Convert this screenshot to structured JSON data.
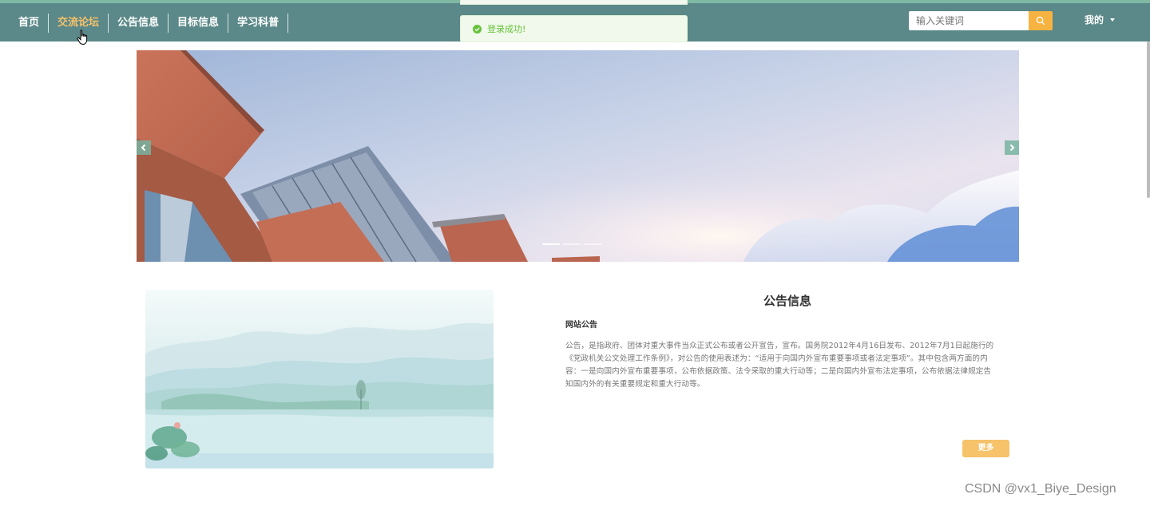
{
  "nav": {
    "items": [
      {
        "label": "首页"
      },
      {
        "label": "交流论坛"
      },
      {
        "label": "公告信息"
      },
      {
        "label": "目标信息"
      },
      {
        "label": "学习科普"
      }
    ]
  },
  "search": {
    "placeholder": "输入关键词"
  },
  "user_menu": {
    "label": "我的"
  },
  "toast": {
    "message": "登录成功!"
  },
  "notice": {
    "heading": "公告信息",
    "subtitle": "网站公告",
    "body": "公告，是指政府、团体对重大事件当众正式公布或者公开宣告，宣布。国务院2012年4月16日发布、2012年7月1日起施行的《党政机关公文处理工作条例》，对公告的使用表述为：“适用于向国内外宣布重要事项或者法定事项”。其中包含两方面的内容：一是向国内外宣布重要事项，公布依据政策、法令采取的重大行动等；二是向国内外宣布法定事项，公布依据法律规定告知国内外的有关重要规定和重大行动等。",
    "more_label": "更多"
  },
  "watermark": "CSDN @vx1_Biye_Design",
  "colors": {
    "nav_bg": "#5b8888",
    "accent": "#f6c26a",
    "search_btn": "#f7b341",
    "success": "#67c23a"
  }
}
